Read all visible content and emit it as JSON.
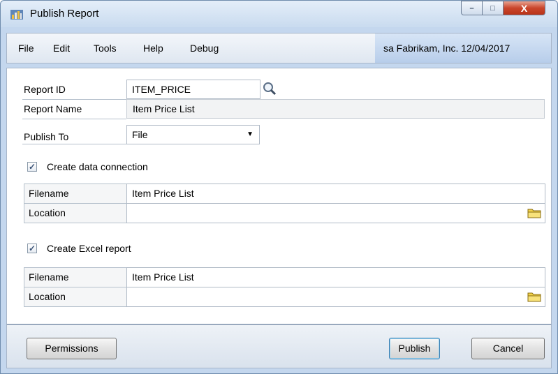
{
  "window": {
    "title": "Publish Report",
    "min_glyph": "–",
    "max_glyph": "□",
    "close_glyph": "X"
  },
  "menu": {
    "items": [
      "File",
      "Edit",
      "Tools",
      "Help",
      "Debug"
    ],
    "user_info": "sa  Fabrikam, Inc.  12/04/2017"
  },
  "form": {
    "report_id_label": "Report ID",
    "report_id_value": "ITEM_PRICE",
    "report_name_label": "Report Name",
    "report_name_value": "Item Price List",
    "publish_to_label": "Publish To",
    "publish_to_value": "File",
    "data_connection": {
      "checkbox_label": "Create data connection",
      "checked": true,
      "filename_label": "Filename",
      "filename_value": "Item Price List",
      "location_label": "Location",
      "location_value": ""
    },
    "excel_report": {
      "checkbox_label": "Create Excel report",
      "checked": true,
      "filename_label": "Filename",
      "filename_value": "Item Price List",
      "location_label": "Location",
      "location_value": ""
    }
  },
  "buttons": {
    "permissions": "Permissions",
    "publish": "Publish",
    "cancel": "Cancel"
  },
  "glyphs": {
    "check": "✓",
    "dropdown": "▼"
  }
}
